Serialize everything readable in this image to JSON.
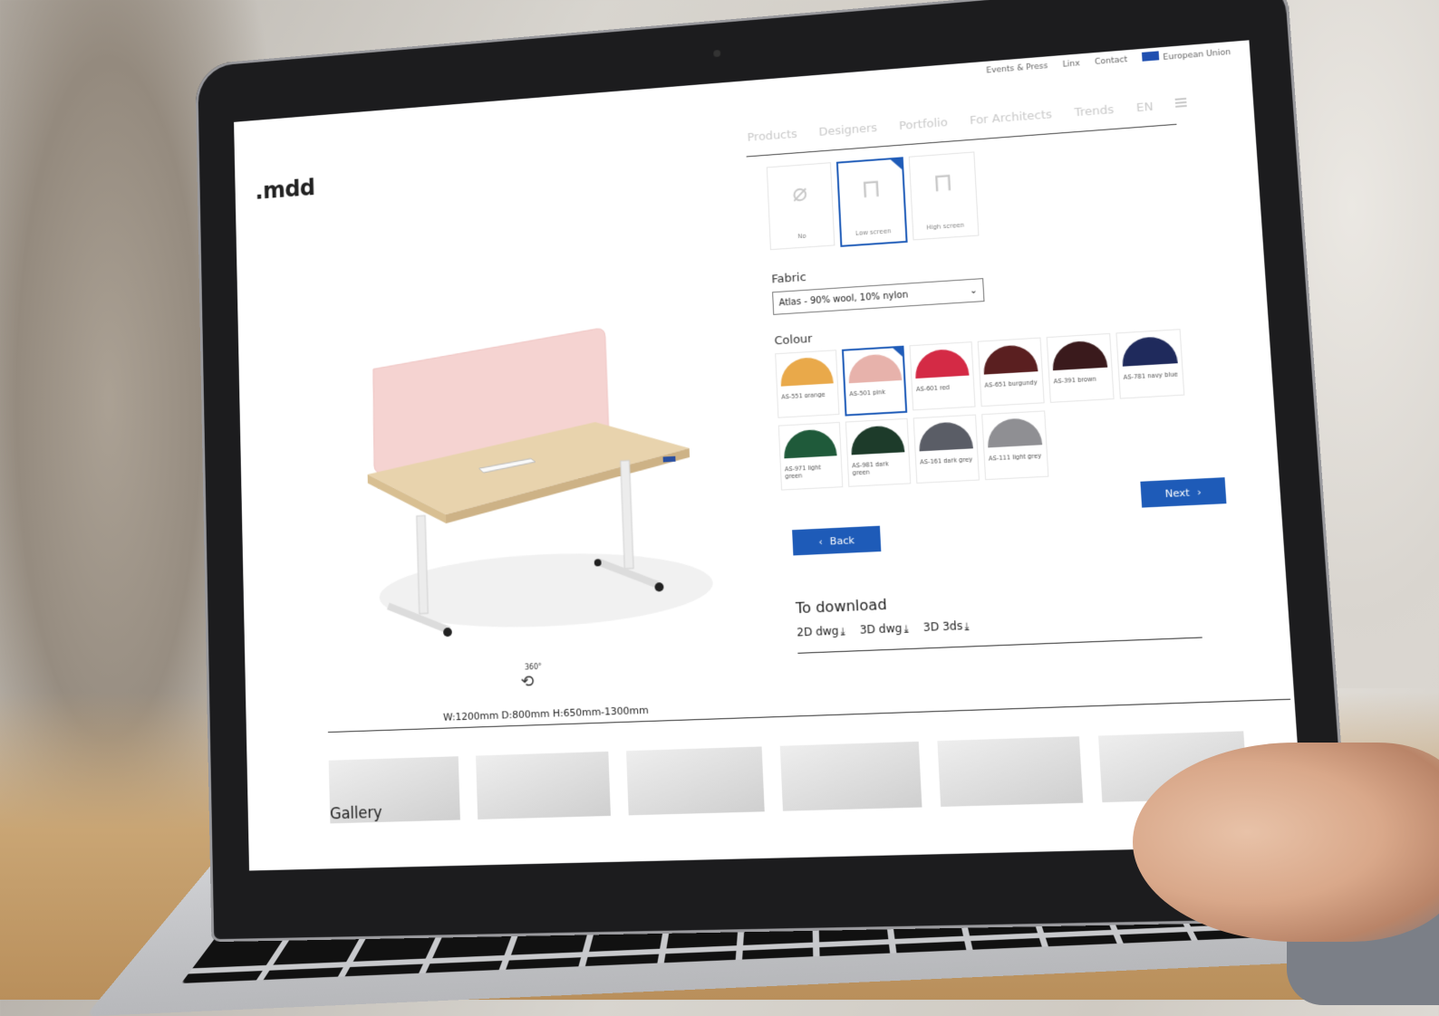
{
  "topbar": {
    "events_press": "Events & Press",
    "linx": "Linx",
    "contact": "Contact",
    "region": "European Union"
  },
  "brand": {
    "logo": ".mdd"
  },
  "nav": {
    "items": [
      "Products",
      "Designers",
      "Portfolio",
      "For Architects",
      "Trends"
    ],
    "language": "EN"
  },
  "configurator": {
    "screen_options": [
      {
        "label": "No",
        "selected": false
      },
      {
        "label": "Low screen",
        "selected": true
      },
      {
        "label": "High screen",
        "selected": false
      }
    ],
    "fabric_label": "Fabric",
    "fabric_value": "Atlas - 90% wool, 10% nylon",
    "colour_label": "Colour",
    "colours": [
      {
        "label": "AS-551 orange",
        "color": "#e9a94a",
        "selected": false
      },
      {
        "label": "AS-501 pink",
        "color": "#e7b2ab",
        "selected": true
      },
      {
        "label": "AS-601 red",
        "color": "#d42a45",
        "selected": false
      },
      {
        "label": "AS-651 burgundy",
        "color": "#5a1f20",
        "selected": false
      },
      {
        "label": "AS-391 brown",
        "color": "#3a1a1c",
        "selected": false
      },
      {
        "label": "AS-781 navy blue",
        "color": "#1f2a5c",
        "selected": false
      },
      {
        "label": "AS-971 light green",
        "color": "#1f5a3a",
        "selected": false
      },
      {
        "label": "AS-981 dark green",
        "color": "#1d3b2a",
        "selected": false
      },
      {
        "label": "AS-161 dark grey",
        "color": "#5a5d66",
        "selected": false
      },
      {
        "label": "AS-111 light grey",
        "color": "#8f8f93",
        "selected": false
      }
    ],
    "next_label": "Next",
    "back_label": "Back",
    "download_title": "To download",
    "downloads": [
      "2D dwg",
      "3D dwg",
      "3D 3ds"
    ]
  },
  "product": {
    "rotate_label": "360°",
    "dimensions": "W:1200mm D:800mm H:650mm-1300mm"
  },
  "gallery": {
    "title": "Gallery"
  },
  "colors": {
    "accent": "#1e5bb8",
    "screen_panel": "#f3cfcf",
    "desktop_wood": "#e6cfa6",
    "frame": "#e6e6e6"
  }
}
